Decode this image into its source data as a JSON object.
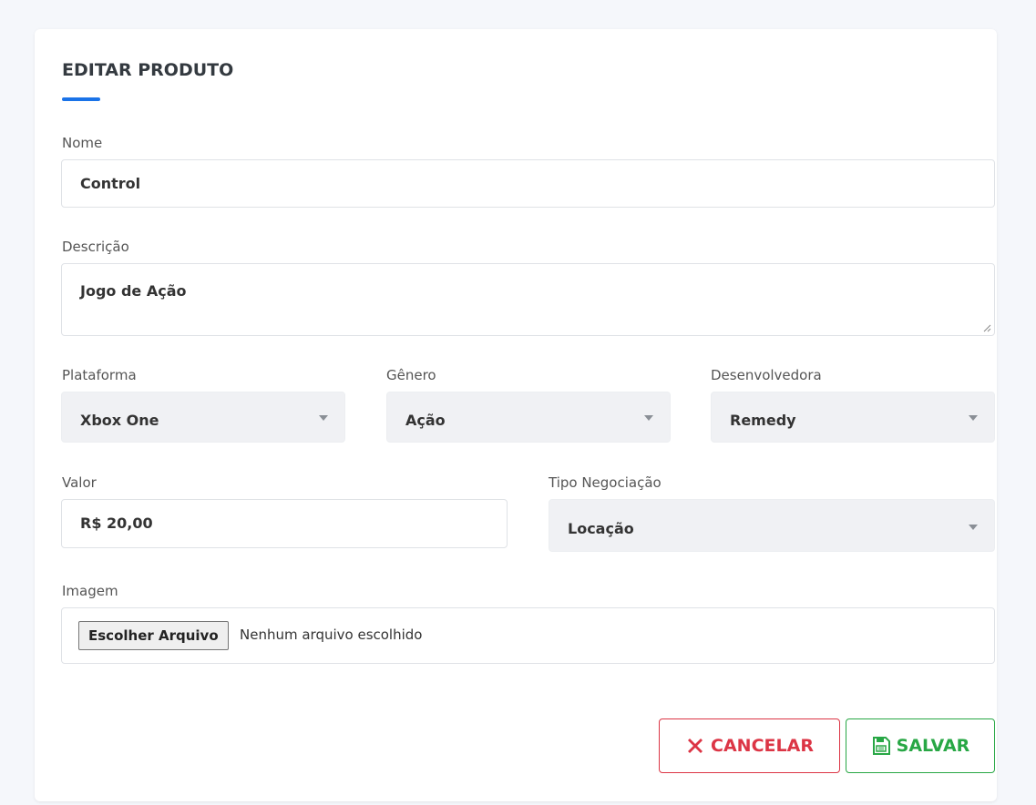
{
  "form": {
    "title": "EDITAR PRODUTO",
    "nome": {
      "label": "Nome",
      "value": "Control"
    },
    "descricao": {
      "label": "Descrição",
      "value": "Jogo de Ação"
    },
    "plataforma": {
      "label": "Plataforma",
      "value": "Xbox One"
    },
    "genero": {
      "label": "Gênero",
      "value": "Ação"
    },
    "desenvolvedora": {
      "label": "Desenvolvedora",
      "value": "Remedy"
    },
    "valor": {
      "label": "Valor",
      "value": "R$ 20,00"
    },
    "tipo_negociacao": {
      "label": "Tipo Negociação",
      "value": "Locação"
    },
    "imagem": {
      "label": "Imagem",
      "button_label": "Escolher Arquivo",
      "status": "Nenhum arquivo escolhido"
    }
  },
  "actions": {
    "cancel_label": "CANCELAR",
    "save_label": "SALVAR",
    "cancel_icon": "x-icon",
    "save_icon": "floppy-disk-icon"
  },
  "colors": {
    "accent": "#1a73e8",
    "cancel": "#dc3545",
    "save": "#28a745"
  }
}
